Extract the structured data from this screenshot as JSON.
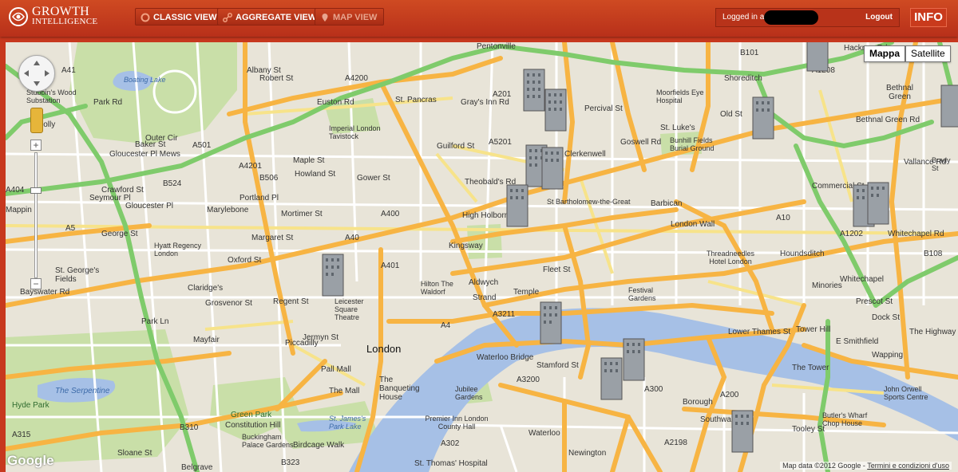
{
  "header": {
    "logo_line1": "GROWTH",
    "logo_line2": "INTELLIGENCE",
    "nav": [
      {
        "label": "CLASSIC VIEW",
        "icon": "circle-icon",
        "enabled": true
      },
      {
        "label": "AGGREGATE VIEW",
        "icon": "nodes-icon",
        "enabled": true
      },
      {
        "label": "MAP VIEW",
        "icon": "map-pin-icon",
        "enabled": false
      }
    ],
    "logged_in_label": "Logged in as:",
    "logout_label": "Logout",
    "info_label": "INFO"
  },
  "map": {
    "type_buttons": [
      "Mappa",
      "Satellite"
    ],
    "active_type": "Mappa",
    "attribution": "Map data ©2012 Google",
    "terms_link": "Termini e condizioni d'uso",
    "logo": "Google",
    "zoom_in": "+",
    "zoom_out": "−",
    "labels": [
      {
        "text": "Pentonville",
        "k": "n"
      },
      {
        "text": "Shoreditch",
        "k": "n"
      },
      {
        "text": "Bethnal Green",
        "k": "n"
      },
      {
        "text": "Hackney Rd",
        "k": "n"
      },
      {
        "text": "St. Pancras",
        "k": "n"
      },
      {
        "text": "Robert St",
        "k": "n"
      },
      {
        "text": "Euston Rd",
        "k": "n"
      },
      {
        "text": "Boating Lake",
        "k": "w"
      },
      {
        "text": "Outer Cir",
        "k": "n"
      },
      {
        "text": "Marylebone",
        "k": "n"
      },
      {
        "text": "Imperial London Tavistock",
        "k": "n"
      },
      {
        "text": "Clerkenwell",
        "k": "n"
      },
      {
        "text": "St. Luke's",
        "k": "n"
      },
      {
        "text": "Bunhill Fields Burial Ground",
        "k": "n"
      },
      {
        "text": "Moorfields Eye Hospital",
        "k": "n"
      },
      {
        "text": "Theobald's Rd",
        "k": "n"
      },
      {
        "text": "High Holborn",
        "k": "n"
      },
      {
        "text": "St Bartholomew-the-Great",
        "k": "n"
      },
      {
        "text": "Barbican",
        "k": "n"
      },
      {
        "text": "London Wall",
        "k": "n"
      },
      {
        "text": "Hyatt Regency London",
        "k": "n"
      },
      {
        "text": "Oxford St",
        "k": "n"
      },
      {
        "text": "Margaret St",
        "k": "n"
      },
      {
        "text": "Mortimer St",
        "k": "n"
      },
      {
        "text": "St. George's Fields",
        "k": "n"
      },
      {
        "text": "Bayswater Rd",
        "k": "n"
      },
      {
        "text": "Claridge's",
        "k": "n"
      },
      {
        "text": "Grosvenor St",
        "k": "n"
      },
      {
        "text": "Hilton The Waldorf",
        "k": "n"
      },
      {
        "text": "Aldwych",
        "k": "n"
      },
      {
        "text": "Strand",
        "k": "n"
      },
      {
        "text": "Fleet St",
        "k": "n"
      },
      {
        "text": "Temple",
        "k": "n"
      },
      {
        "text": "Threadneedles Hotel London",
        "k": "n"
      },
      {
        "text": "Festival Gardens",
        "k": "n"
      },
      {
        "text": "Whitechapel",
        "k": "n"
      },
      {
        "text": "Whitechapel Rd",
        "k": "n"
      },
      {
        "text": "Leicester Square Theatre",
        "k": "n"
      },
      {
        "text": "Piccadilly",
        "k": "n"
      },
      {
        "text": "Jermyn St",
        "k": "n"
      },
      {
        "text": "Mayfair",
        "k": "n"
      },
      {
        "text": "London",
        "k": "big"
      },
      {
        "text": "Pall Mall",
        "k": "n"
      },
      {
        "text": "The Mall",
        "k": "n"
      },
      {
        "text": "The Banqueting House",
        "k": "n"
      },
      {
        "text": "Lower Thames St",
        "k": "n"
      },
      {
        "text": "Tower Hill",
        "k": "n"
      },
      {
        "text": "The Tower",
        "k": "n"
      },
      {
        "text": "Wapping",
        "k": "n"
      },
      {
        "text": "The Highway",
        "k": "n"
      },
      {
        "text": "E Smithfield",
        "k": "n"
      },
      {
        "text": "Prescot St",
        "k": "n"
      },
      {
        "text": "The Serpentine",
        "k": "w"
      },
      {
        "text": "Hyde Park",
        "k": "p"
      },
      {
        "text": "Green Park",
        "k": "p"
      },
      {
        "text": "Constitution Hill",
        "k": "n"
      },
      {
        "text": "St. James's Park Lake",
        "k": "w"
      },
      {
        "text": "Buckingham Palace Gardens",
        "k": "n"
      },
      {
        "text": "Birdcage Walk",
        "k": "n"
      },
      {
        "text": "Jubilee Gardens",
        "k": "n"
      },
      {
        "text": "Premier Inn London County Hall",
        "k": "n"
      },
      {
        "text": "Waterloo",
        "k": "n"
      },
      {
        "text": "Stamford St",
        "k": "n"
      },
      {
        "text": "Waterloo Bridge",
        "k": "n"
      },
      {
        "text": "Newington",
        "k": "n"
      },
      {
        "text": "Borough",
        "k": "n"
      },
      {
        "text": "Southwark",
        "k": "n"
      },
      {
        "text": "Butler's Wharf Chop House",
        "k": "n"
      },
      {
        "text": "John Orwell Sports Centre",
        "k": "n"
      },
      {
        "text": "St. Thomas' Hospital",
        "k": "n"
      },
      {
        "text": "Crawford St",
        "k": "n"
      },
      {
        "text": "George St",
        "k": "n"
      },
      {
        "text": "Maple St",
        "k": "n"
      },
      {
        "text": "Howland St",
        "k": "n"
      },
      {
        "text": "Gower St",
        "k": "n"
      },
      {
        "text": "Guilford St",
        "k": "n"
      },
      {
        "text": "Percival St",
        "k": "n"
      },
      {
        "text": "Old St",
        "k": "n"
      },
      {
        "text": "Bethnal Green Rd",
        "k": "n"
      },
      {
        "text": "Commercial St",
        "k": "n"
      },
      {
        "text": "Houndsditch",
        "k": "n"
      },
      {
        "text": "Minories",
        "k": "n"
      },
      {
        "text": "Regent St",
        "k": "n"
      },
      {
        "text": "Park Ln",
        "k": "n"
      },
      {
        "text": "Kingsway",
        "k": "n"
      },
      {
        "text": "Gray's Inn Rd",
        "k": "n"
      },
      {
        "text": "Goswell Rd",
        "k": "n"
      },
      {
        "text": "Baker St",
        "k": "n"
      },
      {
        "text": "Park Rd",
        "k": "n"
      },
      {
        "text": "Albany St",
        "k": "n"
      },
      {
        "text": "Portland Pl",
        "k": "n"
      },
      {
        "text": "Brady St",
        "k": "n"
      },
      {
        "text": "Vallance Rd",
        "k": "n"
      },
      {
        "text": "Dock St",
        "k": "n"
      },
      {
        "text": "Tooley St",
        "k": "n"
      },
      {
        "text": "Sloane St",
        "k": "n"
      },
      {
        "text": "Belgrave",
        "k": "n"
      },
      {
        "text": "A501",
        "k": "n"
      },
      {
        "text": "A40",
        "k": "n"
      },
      {
        "text": "A4",
        "k": "n"
      },
      {
        "text": "A3211",
        "k": "n"
      },
      {
        "text": "A10",
        "k": "n"
      },
      {
        "text": "A1202",
        "k": "n"
      },
      {
        "text": "A200",
        "k": "n"
      },
      {
        "text": "A302",
        "k": "n"
      },
      {
        "text": "A315",
        "k": "n"
      },
      {
        "text": "A3200",
        "k": "n"
      },
      {
        "text": "A2198",
        "k": "n"
      },
      {
        "text": "A201",
        "k": "n"
      },
      {
        "text": "A300",
        "k": "n"
      },
      {
        "text": "A1208",
        "k": "n"
      },
      {
        "text": "A5201",
        "k": "n"
      },
      {
        "text": "A4200",
        "k": "n"
      },
      {
        "text": "A400",
        "k": "n"
      },
      {
        "text": "A4201",
        "k": "n"
      },
      {
        "text": "A401",
        "k": "n"
      },
      {
        "text": "A404",
        "k": "n"
      },
      {
        "text": "A41",
        "k": "n"
      },
      {
        "text": "A5",
        "k": "n"
      },
      {
        "text": "B524",
        "k": "n"
      },
      {
        "text": "B506",
        "k": "n"
      },
      {
        "text": "B101",
        "k": "n"
      },
      {
        "text": "B108",
        "k": "n"
      },
      {
        "text": "B310",
        "k": "n"
      },
      {
        "text": "B323",
        "k": "n"
      },
      {
        "text": "Stubbin's Wood Substation",
        "k": "n"
      },
      {
        "text": "Holly",
        "k": "n"
      },
      {
        "text": "Seymour Pl",
        "k": "n"
      },
      {
        "text": "Gloucester Pl",
        "k": "n"
      },
      {
        "text": "Gloucester Pl Mews",
        "k": "n"
      },
      {
        "text": "Mappin",
        "k": "n"
      }
    ]
  }
}
